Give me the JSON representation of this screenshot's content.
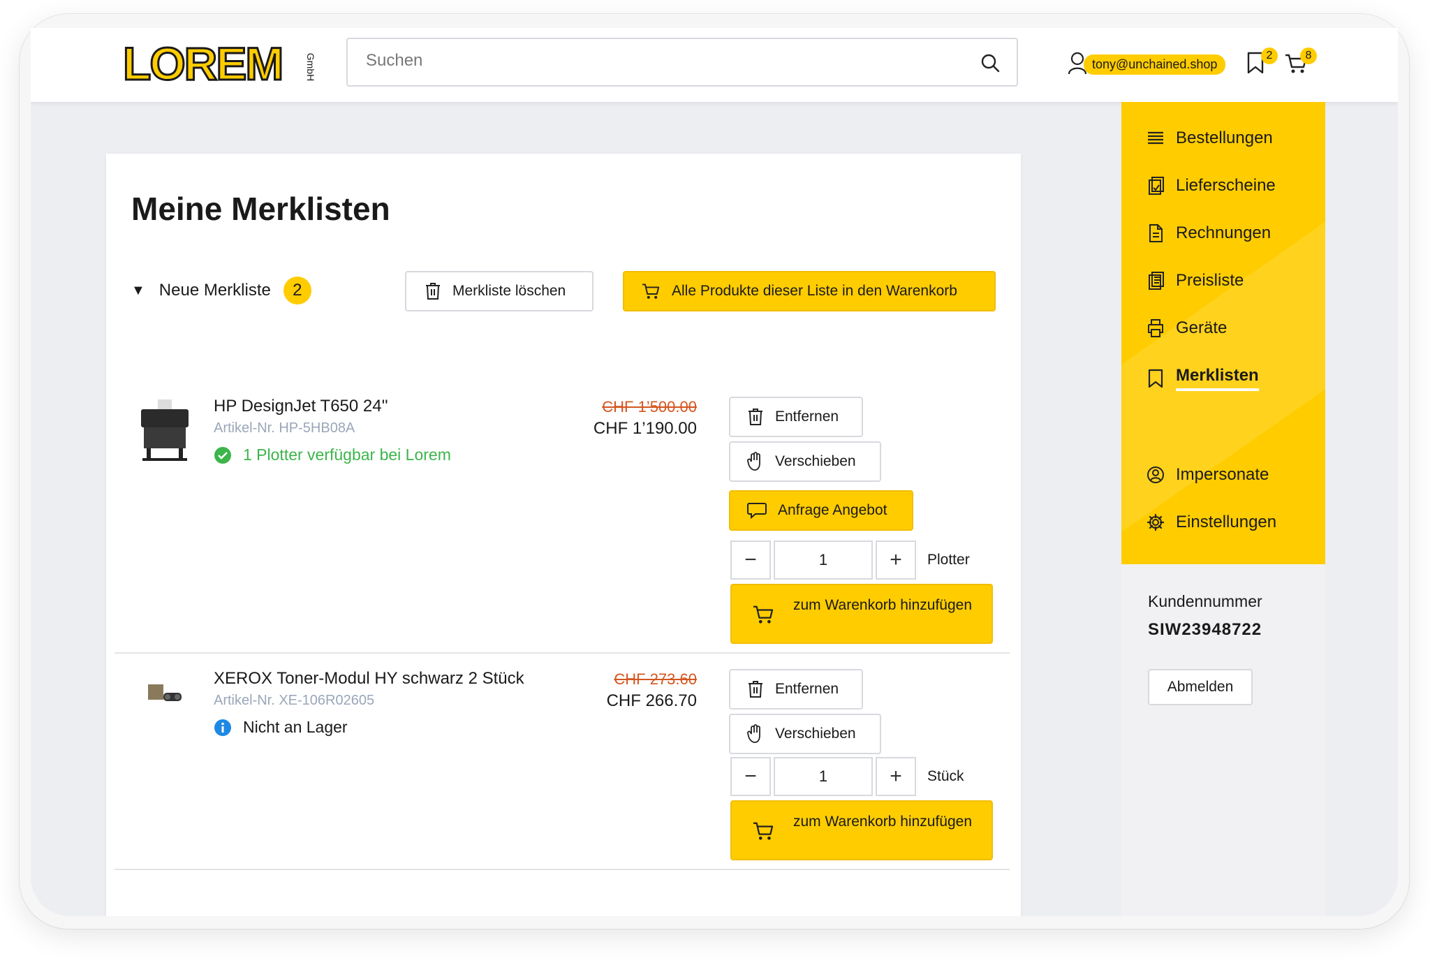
{
  "header": {
    "logo_text": "LOREM",
    "logo_suffix": "GmbH",
    "search_placeholder": "Suchen",
    "user_email": "tony@unchained.shop",
    "wishlist_count": "2",
    "cart_count": "8"
  },
  "main": {
    "title": "Meine Merklisten",
    "list_name": "Neue Merkliste",
    "list_count": "2",
    "delete_list_label": "Merkliste löschen",
    "add_all_label": "Alle Produkte dieser Liste in den Warenkorb"
  },
  "products": [
    {
      "name": "HP DesignJet T650 24''",
      "sku": "Artikel-Nr. HP-5HB08A",
      "stock": "1 Plotter verfügbar bei Lorem",
      "stock_status": "available",
      "price_old": "CHF 1’500.00",
      "price_new": "CHF 1’190.00",
      "remove_label": "Entfernen",
      "move_label": "Verschieben",
      "quote_label": "Anfrage Angebot",
      "quantity": "1",
      "unit": "Plotter",
      "add_to_cart_label": "zum Warenkorb hinzufügen"
    },
    {
      "name": "XEROX Toner-Modul HY schwarz 2 Stück",
      "sku": "Artikel-Nr. XE-106R02605",
      "stock": "Nicht an Lager",
      "stock_status": "info",
      "price_old": "CHF 273.60",
      "price_new": "CHF 266.70",
      "remove_label": "Entfernen",
      "move_label": "Verschieben",
      "quantity": "1",
      "unit": "Stück",
      "add_to_cart_label": "zum Warenkorb hinzufügen"
    }
  ],
  "sidebar": {
    "items": [
      {
        "label": "Bestellungen",
        "icon": "list-icon"
      },
      {
        "label": "Lieferscheine",
        "icon": "clipboard-icon"
      },
      {
        "label": "Rechnungen",
        "icon": "document-icon"
      },
      {
        "label": "Preisliste",
        "icon": "pricelist-icon"
      },
      {
        "label": "Geräte",
        "icon": "printer-icon"
      },
      {
        "label": "Merklisten",
        "icon": "bookmark-icon",
        "active": true
      },
      {
        "label": "Impersonate",
        "icon": "user-circle-icon"
      },
      {
        "label": "Einstellungen",
        "icon": "gear-icon"
      }
    ],
    "customer_label": "Kundennummer",
    "customer_number": "SIW23948722",
    "logout_label": "Abmelden"
  },
  "colors": {
    "accent": "#ffcc00",
    "old_price": "#d4561f",
    "available": "#3cb54a",
    "info": "#1e88e5",
    "sku": "#9aa6b8"
  }
}
